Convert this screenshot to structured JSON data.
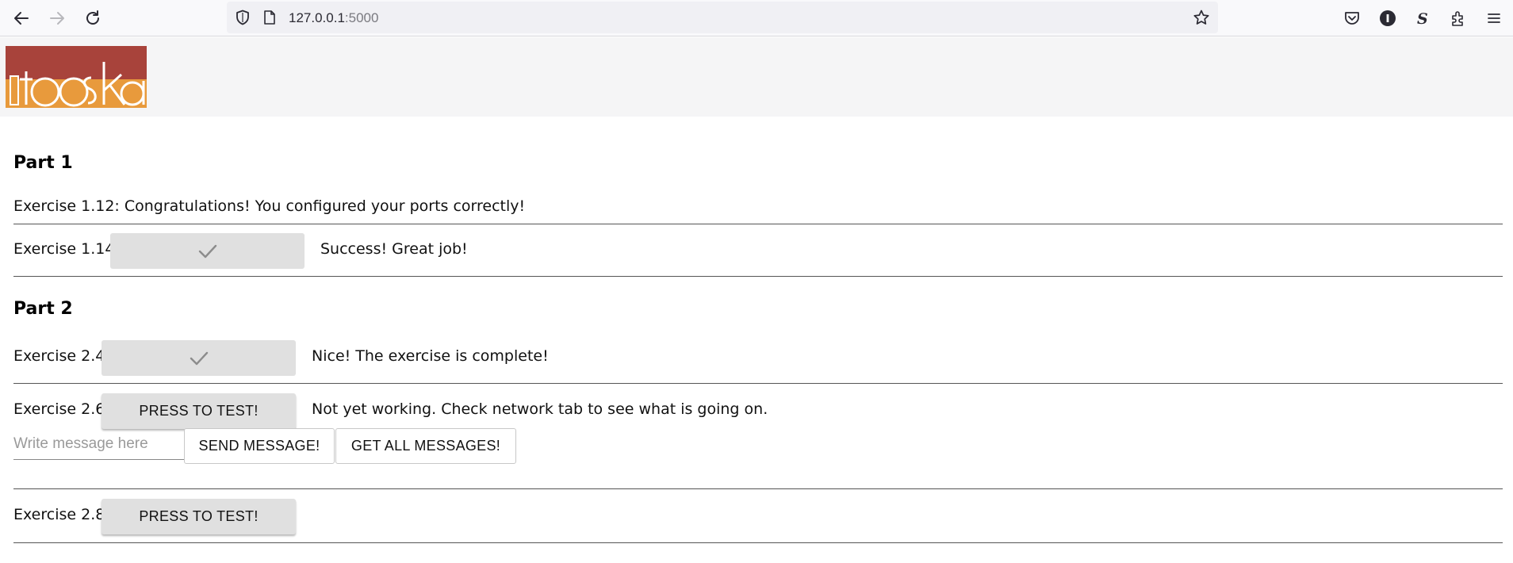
{
  "browser": {
    "url_host": "127.0.0.1",
    "url_port": ":5000"
  },
  "part1": {
    "title": "Part 1",
    "ex112": {
      "text": "Exercise 1.12: Congratulations! You configured your ports correctly!"
    },
    "ex114": {
      "label": "Exercise 1.14:",
      "status": "Success! Great job!"
    }
  },
  "part2": {
    "title": "Part 2",
    "ex24": {
      "label": "Exercise 2.4:",
      "status": "Nice! The exercise is complete!"
    },
    "ex26": {
      "label": "Exercise 2.6:",
      "button": "PRESS TO TEST!",
      "status": "Not yet working. Check network tab to see what is going on.",
      "input_placeholder": "Write message here",
      "input_value": "",
      "send_button": "SEND MESSAGE!",
      "get_button": "GET ALL MESSAGES!"
    },
    "ex28": {
      "label": "Exercise 2.8:",
      "button": "PRESS TO TEST!"
    }
  },
  "colors": {
    "logo_red": "#a8433b",
    "logo_orange": "#e89a3c",
    "button_grey": "#e0e0e0",
    "header_bg": "#f5f5f6"
  },
  "icons": {
    "back": "arrow-left-icon",
    "forward": "arrow-right-icon",
    "reload": "reload-icon",
    "shield": "shield-icon",
    "page": "page-icon",
    "bookmark": "star-icon",
    "pocket": "pocket-icon",
    "account": "account-icon",
    "extension_s": "s-extension-icon",
    "extensions": "puzzle-icon",
    "menu": "hamburger-menu-icon",
    "check": "check-icon"
  }
}
